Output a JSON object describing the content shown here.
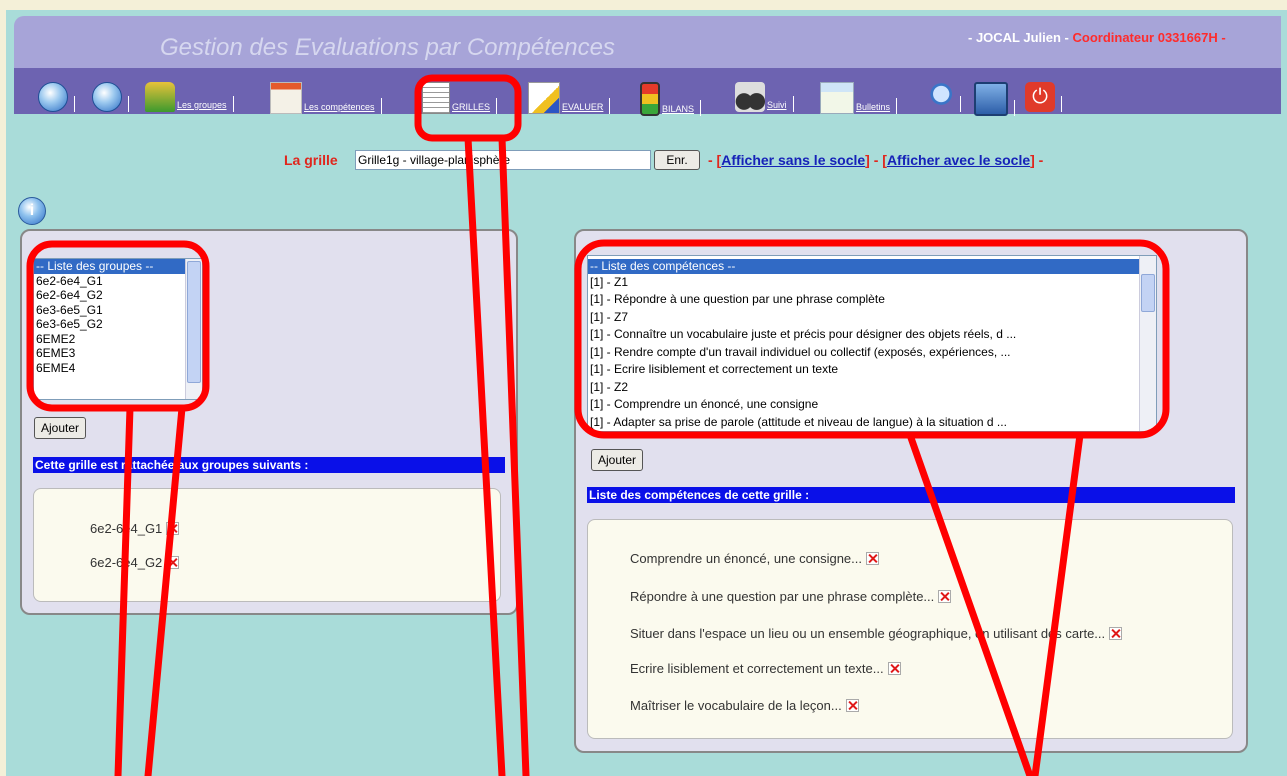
{
  "header": {
    "title": "Gestion des Evaluations par Compétences",
    "user_prefix": "- JOCAL Julien - ",
    "user_role": "Coordinateur 0331667H -"
  },
  "toolbar": {
    "items": [
      {
        "icon": "home-icon",
        "label": ""
      },
      {
        "icon": "info-icon",
        "label": ""
      },
      {
        "icon": "groups-icon",
        "label": "Les groupes"
      },
      {
        "icon": "competences-icon",
        "label": "Les compétences"
      },
      {
        "icon": "grid-icon",
        "label": "GRILLES"
      },
      {
        "icon": "pencil-icon",
        "label": "EVALUER"
      },
      {
        "icon": "traffic-light-icon",
        "label": "BILANS"
      },
      {
        "icon": "binoculars-icon",
        "label": "Suivi"
      },
      {
        "icon": "bulletins-icon",
        "label": "Bulletins"
      },
      {
        "icon": "search-user-icon",
        "label": ""
      },
      {
        "icon": "briefcase-icon",
        "label": ""
      },
      {
        "icon": "power-icon",
        "label": ""
      }
    ]
  },
  "grille": {
    "label": "La grille",
    "value": "Grille1g - village-planisphère",
    "save_label": "Enr.",
    "sep1": "- [",
    "link_without": "Afficher sans le socle",
    "sep2": "] - [",
    "link_with": "Afficher avec le socle",
    "sep3": "] -"
  },
  "groups_panel": {
    "list": [
      "-- Liste des groupes --",
      "6e2-6e4_G1",
      "6e2-6e4_G2",
      "6e3-6e5_G1",
      "6e3-6e5_G2",
      "6EME2",
      "6EME3",
      "6EME4"
    ],
    "add_label": "Ajouter",
    "attached_title": "Cette grille est rattachée aux groupes suivants :",
    "attached": [
      "6e2-6e4_G1",
      "6e2-6e4_G2"
    ]
  },
  "competences_panel": {
    "list": [
      "-- Liste des compétences --",
      "[1] - Z1",
      "[1] - Répondre à une question par une phrase complète",
      "[1] - Z7",
      "[1] - Connaître un vocabulaire juste et précis pour désigner des objets réels, d ...",
      "[1] - Rendre compte d'un travail individuel ou collectif (exposés, expériences, ...",
      "[1] - Ecrire lisiblement et correctement un texte",
      "[1] - Z2",
      "[1] - Comprendre un énoncé, une consigne",
      "[1] - Adapter sa prise de parole (attitude et niveau de langue) à la situation d ..."
    ],
    "add_label": "Ajouter",
    "grid_title": "Liste des compétences de cette grille :",
    "grid_items": [
      "Comprendre un énoncé, une consigne...",
      "Répondre à une question par une phrase complète...",
      "Situer dans l'espace un lieu ou un ensemble géographique, en utilisant des carte...",
      "Ecrire lisiblement et correctement un texte...",
      "Maîtriser le vocabulaire de la leçon..."
    ]
  },
  "colors": {
    "background": "#a9dcd9",
    "banner": "#a7a4d8",
    "toolbar": "#6d63b1",
    "accent_red": "#e0261d",
    "section_bar": "#0a10e8",
    "annotation": "#ff0000"
  }
}
